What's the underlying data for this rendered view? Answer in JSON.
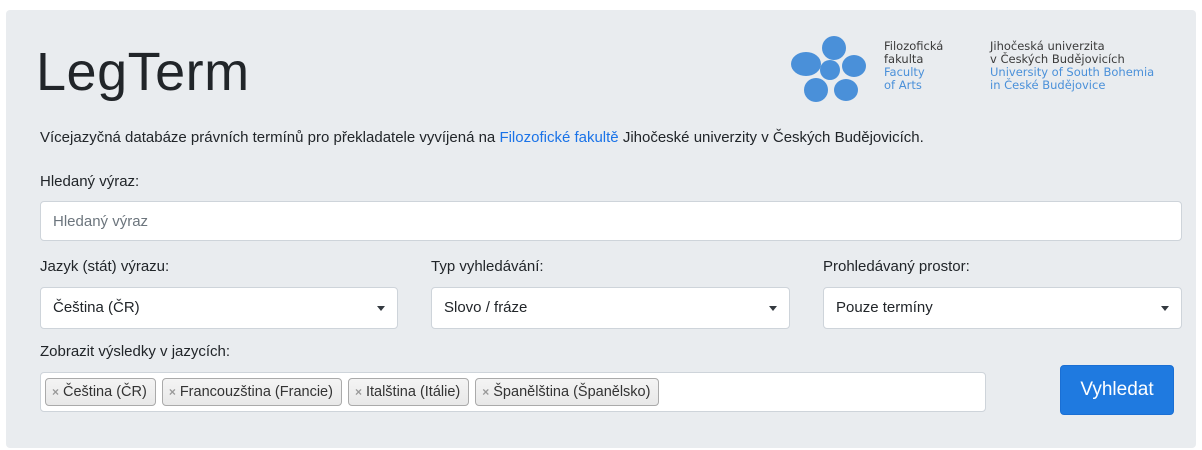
{
  "header": {
    "title": "LegTerm",
    "logo": {
      "icon": "flower-logo",
      "col1_dark": [
        "Filozofická",
        "fakulta"
      ],
      "col1_light": [
        "Faculty",
        "of Arts"
      ],
      "col2_dark": [
        "Jihočeská univerzita",
        "v Českých Budějovicích"
      ],
      "col2_light": [
        "University of South Bohemia",
        "in České Budějovice"
      ]
    }
  },
  "description": {
    "before": "Vícejazyčná databáze právních termínů pro překladatele vyvíjená na ",
    "link": "Filozofické fakultě",
    "after": " Jihočeské univerzity v Českých Budějovicích."
  },
  "search": {
    "label": "Hledaný výraz:",
    "placeholder": "Hledaný výraz",
    "value": ""
  },
  "language": {
    "label": "Jazyk (stát) výrazu:",
    "selected": "Čeština (ČR)"
  },
  "search_type": {
    "label": "Typ vyhledávání:",
    "selected": "Slovo / fráze"
  },
  "scope": {
    "label": "Prohledávaný prostor:",
    "selected": "Pouze termíny"
  },
  "results_languages": {
    "label": "Zobrazit výsledky v jazycích:",
    "remove_symbol": "×",
    "tags": [
      "Čeština (ČR)",
      "Francouzština (Francie)",
      "Italština (Itálie)",
      "Španělština (Španělsko)"
    ]
  },
  "submit_label": "Vyhledat",
  "colors": {
    "accent": "#1f7ae0",
    "link": "#1a73e8",
    "panel": "#e9ecef",
    "logo_blue": "#4a90d9"
  }
}
